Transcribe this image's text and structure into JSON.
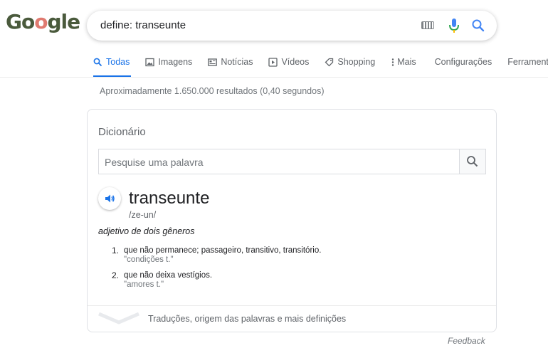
{
  "logo": {
    "letters": [
      {
        "ch": "G",
        "color": "#4a5a3c"
      },
      {
        "ch": "o",
        "color": "#4a5a3c"
      },
      {
        "ch": "o",
        "color": "#e07a70"
      },
      {
        "ch": "g",
        "color": "#4a5a3c"
      },
      {
        "ch": "l",
        "color": "#4a5a3c"
      },
      {
        "ch": "e",
        "color": "#4a5a3c"
      }
    ]
  },
  "search": {
    "query": "define: transeunte"
  },
  "tabs": [
    {
      "label": "Todas",
      "icon": "search-icon",
      "active": true
    },
    {
      "label": "Imagens",
      "icon": "image-icon"
    },
    {
      "label": "Notícias",
      "icon": "news-icon"
    },
    {
      "label": "Vídeos",
      "icon": "play-icon"
    },
    {
      "label": "Shopping",
      "icon": "tag-icon"
    },
    {
      "label": "Mais",
      "icon": "more-vert-icon"
    },
    {
      "label": "Configurações"
    },
    {
      "label": "Ferramentas"
    }
  ],
  "results_stats": "Aproximadamente 1.650.000 resultados (0,40 segundos)",
  "dictionary": {
    "title": "Dicionário",
    "search_placeholder": "Pesquise uma palavra",
    "word": "transeunte",
    "phonetic": "/ze-un/",
    "part_of_speech": "adjetivo de dois gêneros",
    "senses": [
      {
        "num": "1.",
        "definition": "que não permanece; passageiro, transitivo, transitório.",
        "example": "\"condições t.\""
      },
      {
        "num": "2.",
        "definition": "que não deixa vestígios.",
        "example": "\"amores t.\""
      }
    ],
    "footer": "Traduções, origem das palavras e mais definições"
  },
  "feedback": "Feedback",
  "colors": {
    "accent": "#1a73e8"
  }
}
